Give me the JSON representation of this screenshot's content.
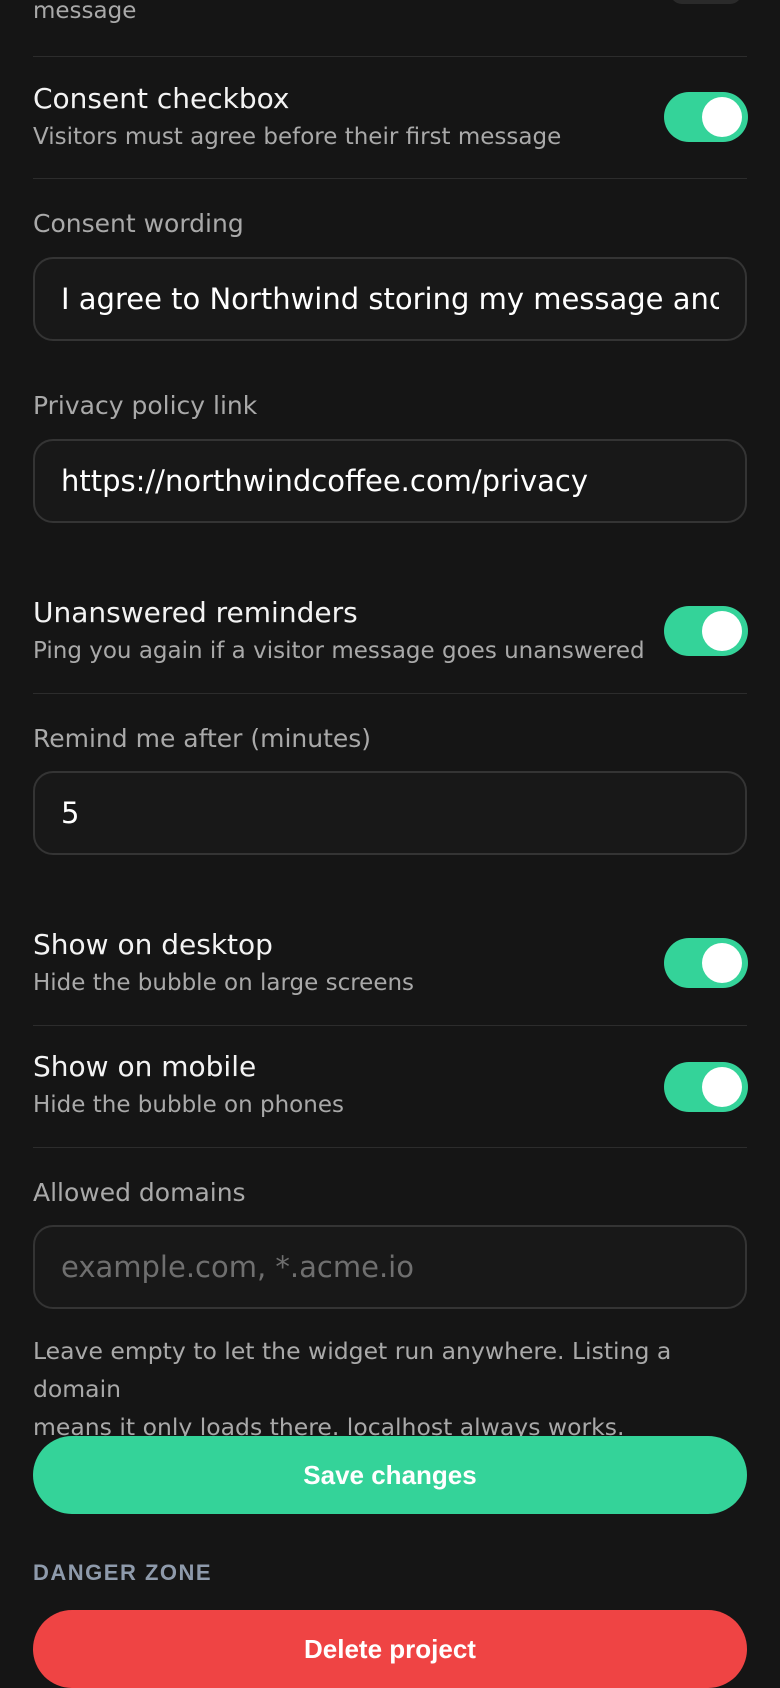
{
  "colors": {
    "background": "#151515",
    "accent": "#34d399",
    "danger": "#ef4444",
    "divider": "#2c2c2c"
  },
  "top_cutoff": {
    "desc_tail": "message"
  },
  "consent_checkbox": {
    "title": "Consent checkbox",
    "description": "Visitors must agree before their first message",
    "enabled": true
  },
  "consent_wording": {
    "label": "Consent wording",
    "value": "I agree to Northwind storing my message and email"
  },
  "privacy_policy": {
    "label": "Privacy policy link",
    "value": "https://northwindcoffee.com/privacy"
  },
  "unanswered_reminders": {
    "title": "Unanswered reminders",
    "description": "Ping you again if a visitor message goes unanswered",
    "enabled": true
  },
  "remind_after": {
    "label": "Remind me after (minutes)",
    "value": "5"
  },
  "show_on_desktop": {
    "title": "Show on desktop",
    "description": "Hide the bubble on large screens",
    "enabled": true
  },
  "show_on_mobile": {
    "title": "Show on mobile",
    "description": "Hide the bubble on phones",
    "enabled": true
  },
  "allowed_domains": {
    "label": "Allowed domains",
    "placeholder": "example.com, *.acme.io",
    "value": "",
    "help_line1": "Leave empty to let the widget run anywhere. Listing a domain",
    "help_line2": "means it only loads there. localhost always works."
  },
  "actions": {
    "save_label": "Save changes"
  },
  "danger_zone": {
    "heading": "DANGER ZONE",
    "delete_label": "Delete project"
  }
}
